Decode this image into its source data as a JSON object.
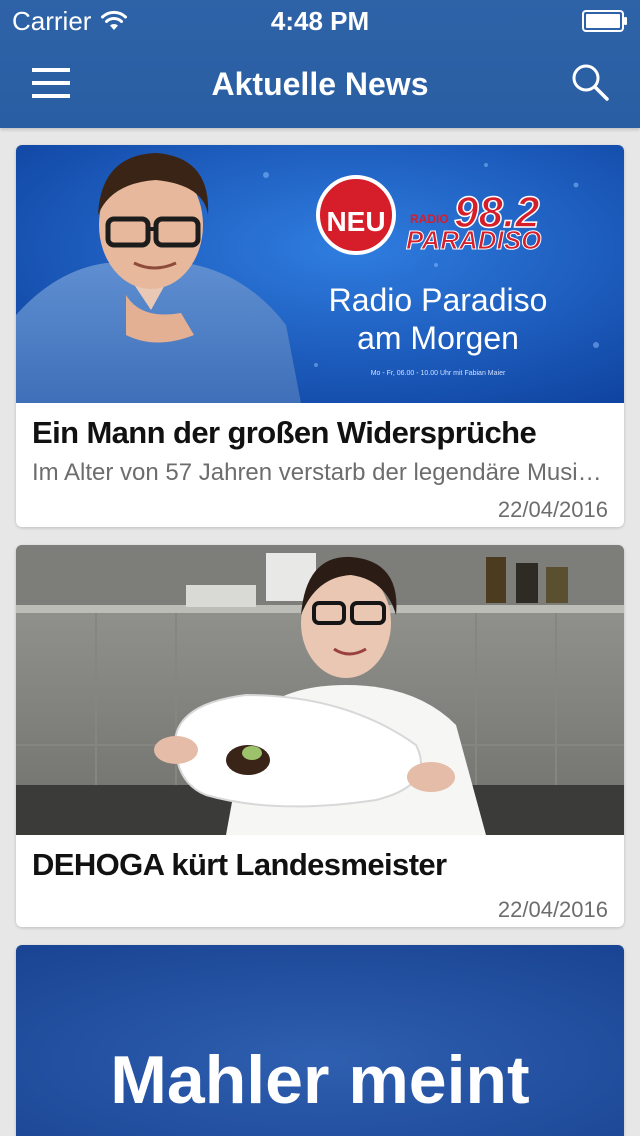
{
  "status_bar": {
    "carrier": "Carrier",
    "time": "4:48 PM"
  },
  "nav": {
    "title": "Aktuelle News",
    "menu_icon": "hamburger-icon",
    "search_icon": "search-icon"
  },
  "colors": {
    "bar": "#2a5ea3",
    "background": "#e7e7e7",
    "card": "#ffffff"
  },
  "articles": [
    {
      "image": {
        "badge": "NEU",
        "station_prefix": "RADIO",
        "frequency": "98.2",
        "station": "PARADISO",
        "show_line1": "Radio Paradiso",
        "show_line2": "am Morgen",
        "small_text": "Mo - Fr, 06.00 - 10.00 Uhr mit Fabian Maier"
      },
      "headline": "Ein Mann der großen Widersprüche",
      "teaser": "Im Alter von 57 Jahren verstarb der legendäre Musiker",
      "date": "22/04/2016"
    },
    {
      "headline": "DEHOGA kürt Landesmeister",
      "date": "22/04/2016"
    },
    {
      "image": {
        "text": "Mahler meint"
      }
    }
  ]
}
